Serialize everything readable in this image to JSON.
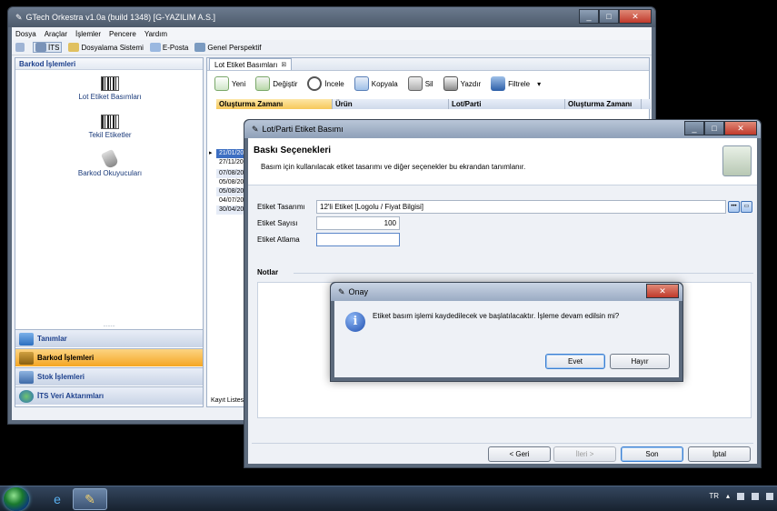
{
  "main_window": {
    "title": "GTech Orkestra v1.0a (build 1348) [G-YAZILIM A.S.]",
    "menu": [
      "Dosya",
      "Araçlar",
      "İşlemler",
      "Pencere",
      "Yardım"
    ],
    "toolbar": [
      "İTS",
      "Dosyalama Sistemi",
      "E-Posta",
      "Genel Perspektif"
    ]
  },
  "left_panel": {
    "title": "Barkod İşlemleri",
    "items": [
      "Lot Etiket Basımları",
      "Tekil Etiketler",
      "Barkod Okuyucuları"
    ],
    "grip": "........",
    "nav": [
      "Tanımlar",
      "Barkod İşlemleri",
      "Stok İşlemleri",
      "İTS Veri Aktarımları"
    ]
  },
  "right_panel": {
    "tab": "Lot Etiket Basımları",
    "tab_close": "⊠",
    "toolbar": [
      "Yeni",
      "Değiştir",
      "İncele",
      "Kopyala",
      "Sil",
      "Yazdır",
      "Filtrele"
    ],
    "columns": [
      "Oluşturma Zamanı",
      "Ürün",
      "Lot/Parti",
      "Oluşturma Zamanı"
    ],
    "rows": [
      "21/01/20",
      "27/11/20",
      "07/08/20",
      "05/08/20",
      "05/08/20",
      "04/07/20",
      "30/04/20"
    ],
    "footer": "Kayıt Listesi"
  },
  "dialog": {
    "title": "Lot/Parti Etiket Basımı",
    "header_title": "Baskı Seçenekleri",
    "header_desc": "Basım için kullanılacak etiket tasarımı ve diğer seçenekler bu ekrandan tanımlanır.",
    "fields": {
      "etiket_tasarimi_label": "Etiket Tasarımı",
      "etiket_tasarimi_value": "12'li Etiket [Logolu / Fiyat Bilgisi]",
      "etiket_sayisi_label": "Etiket Sayısı",
      "etiket_sayisi_value": "100",
      "etiket_atlama_label": "Etiket Atlama",
      "etiket_atlama_value": ""
    },
    "notes_label": "Notlar",
    "buttons": {
      "back": "< Geri",
      "next": "İleri >",
      "finish": "Son",
      "cancel": "İptal"
    }
  },
  "confirm": {
    "title": "Onay",
    "message": "Etiket basım işlemi kaydedilecek ve başlatılacaktır. İşleme devam edilsin mi?",
    "yes": "Evet",
    "no": "Hayır"
  },
  "taskbar": {
    "language": "TR"
  }
}
